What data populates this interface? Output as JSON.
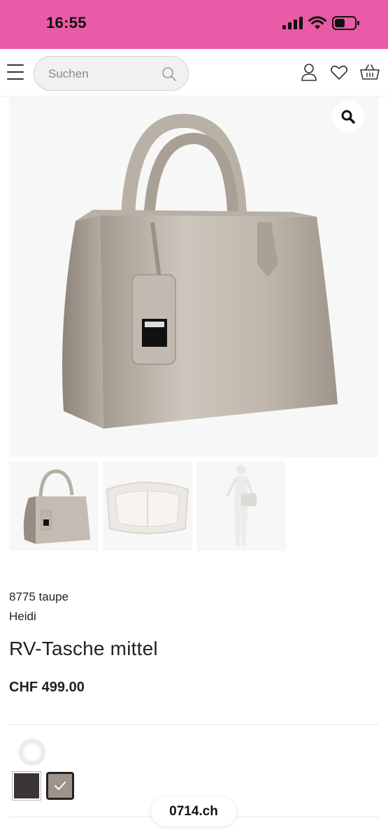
{
  "status_bar": {
    "time": "16:55",
    "background": "#ea5aa6"
  },
  "header": {
    "search_placeholder": "Suchen",
    "icons": [
      "menu-icon",
      "search-icon",
      "account-icon",
      "heart-icon",
      "basket-icon"
    ]
  },
  "gallery": {
    "zoom_icon": "magnifier-icon",
    "thumbnails": [
      "bag-front",
      "bag-interior",
      "bag-on-mannequin"
    ]
  },
  "product": {
    "variant": "8775 taupe",
    "brand": "Heidi",
    "title": "RV-Tasche mittel",
    "price": "CHF 499.00"
  },
  "colors": {
    "swatches": [
      {
        "name": "dark",
        "hex": "#3a3434",
        "selected": false
      },
      {
        "name": "taupe",
        "hex": "#9c948c",
        "selected": true
      }
    ]
  },
  "browser": {
    "domain": "0714.ch"
  }
}
